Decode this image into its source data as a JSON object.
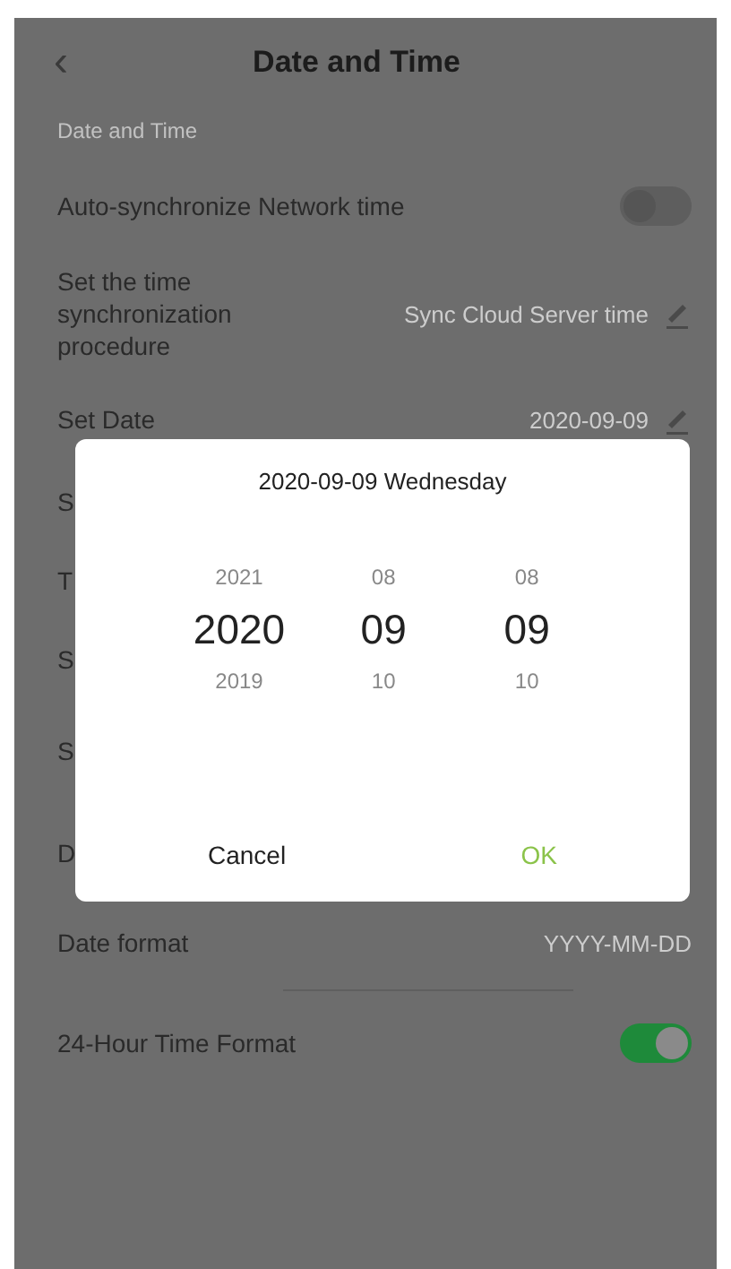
{
  "header": {
    "back": "‹",
    "title": "Date and Time"
  },
  "section_label": "Date and Time",
  "rows": [
    {
      "kind": "toggle",
      "label": "Auto-synchronize Network time",
      "on": false
    },
    {
      "kind": "edit",
      "label": "Set the time synchronization procedure",
      "value": "Sync Cloud Server time"
    },
    {
      "kind": "edit",
      "label": "Set Date",
      "value": "2020-09-09"
    },
    {
      "kind": "hidden",
      "label": "S"
    },
    {
      "kind": "hidden",
      "label": "T"
    },
    {
      "kind": "hidden",
      "label": "S"
    },
    {
      "kind": "hidden",
      "label": "S"
    },
    {
      "kind": "hidden",
      "label": "D"
    },
    {
      "kind": "value",
      "label": "Date format",
      "value": "YYYY-MM-DD"
    },
    {
      "kind": "toggle",
      "label": "24-Hour Time Format",
      "on": true
    }
  ],
  "dialog": {
    "title": "2020-09-09 Wednesday",
    "columns": [
      {
        "items": [
          {
            "text": "2021",
            "selected": false
          },
          {
            "text": "2020",
            "selected": true
          },
          {
            "text": "2019",
            "selected": false
          }
        ]
      },
      {
        "items": [
          {
            "text": "08",
            "selected": false
          },
          {
            "text": "09",
            "selected": true
          },
          {
            "text": "10",
            "selected": false
          }
        ]
      },
      {
        "items": [
          {
            "text": "08",
            "selected": false
          },
          {
            "text": "09",
            "selected": true
          },
          {
            "text": "10",
            "selected": false
          }
        ]
      }
    ],
    "buttons": [
      {
        "kind": "cancel",
        "label": "Cancel"
      },
      {
        "kind": "ok",
        "label": "OK"
      }
    ]
  }
}
